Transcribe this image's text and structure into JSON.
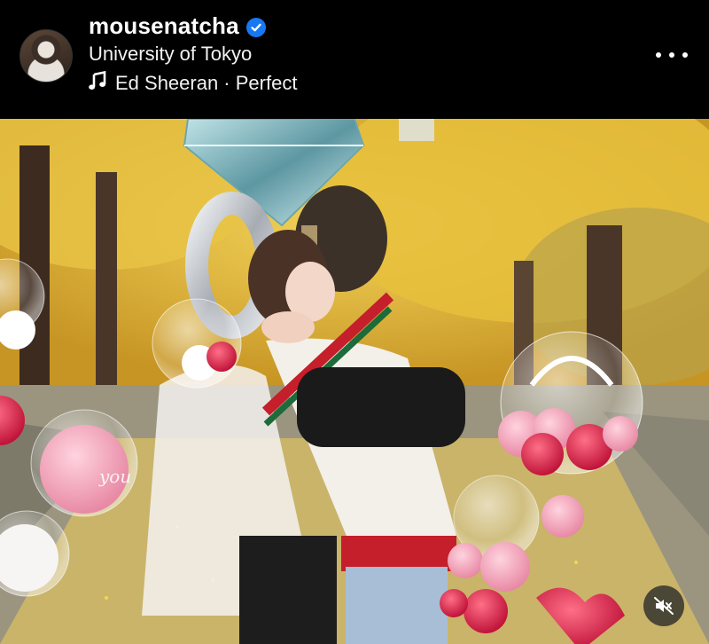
{
  "post_header": {
    "username": "mousenatcha",
    "verified": true,
    "location": "University of Tokyo",
    "music": "Ed Sheeran · Perfect"
  },
  "photo": {
    "balloon_text": "you"
  },
  "colors": {
    "background": "#000000",
    "verified_badge": "#1877f2"
  },
  "icons": {
    "verified": "verified-check-icon",
    "music": "music-note-icon",
    "more": "more-options-icon",
    "mute": "speaker-muted-icon"
  }
}
